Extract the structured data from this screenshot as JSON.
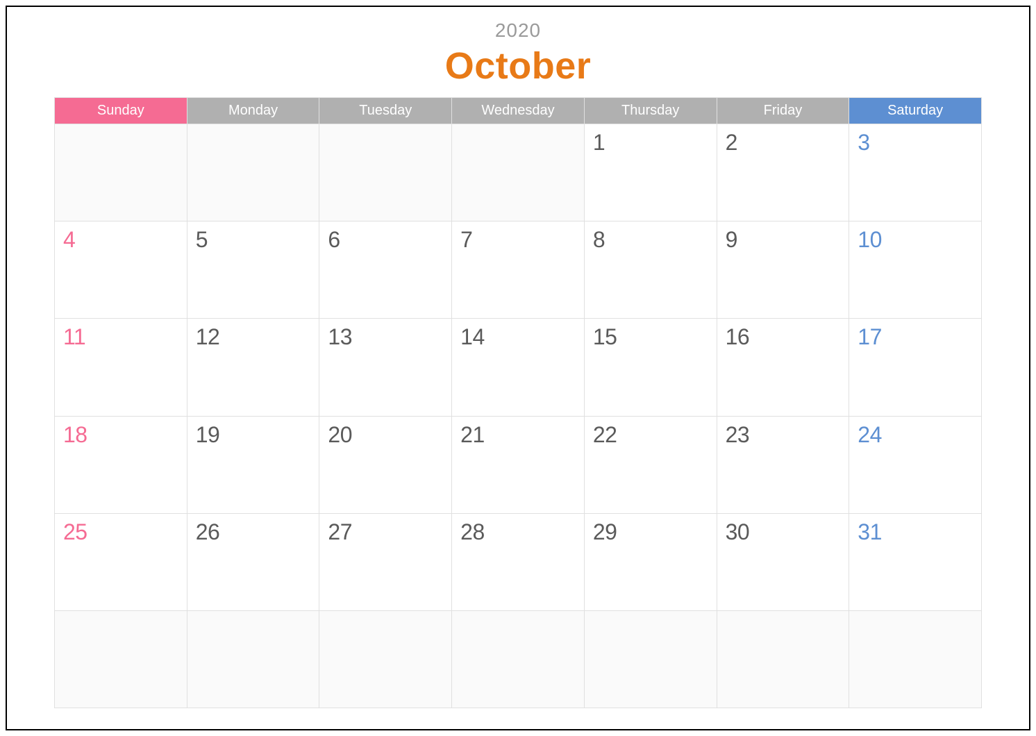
{
  "header": {
    "year": "2020",
    "month": "October"
  },
  "days": {
    "sun": "Sunday",
    "mon": "Monday",
    "tue": "Tuesday",
    "wed": "Wednesday",
    "thu": "Thursday",
    "fri": "Friday",
    "sat": "Saturday"
  },
  "grid": {
    "r0": {
      "c0": "",
      "c1": "",
      "c2": "",
      "c3": "",
      "c4": "1",
      "c5": "2",
      "c6": "3"
    },
    "r1": {
      "c0": "4",
      "c1": "5",
      "c2": "6",
      "c3": "7",
      "c4": "8",
      "c5": "9",
      "c6": "10"
    },
    "r2": {
      "c0": "11",
      "c1": "12",
      "c2": "13",
      "c3": "14",
      "c4": "15",
      "c5": "16",
      "c6": "17"
    },
    "r3": {
      "c0": "18",
      "c1": "19",
      "c2": "20",
      "c3": "21",
      "c4": "22",
      "c5": "23",
      "c6": "24"
    },
    "r4": {
      "c0": "25",
      "c1": "26",
      "c2": "27",
      "c3": "28",
      "c4": "29",
      "c5": "30",
      "c6": "31"
    },
    "r5": {
      "c0": "",
      "c1": "",
      "c2": "",
      "c3": "",
      "c4": "",
      "c5": "",
      "c6": ""
    }
  },
  "colors": {
    "month": "#e87a17",
    "sunday": "#f56b93",
    "saturday": "#5d8fd2",
    "weekday_header": "#b0b0b0",
    "day_text": "#5a5a5a"
  }
}
